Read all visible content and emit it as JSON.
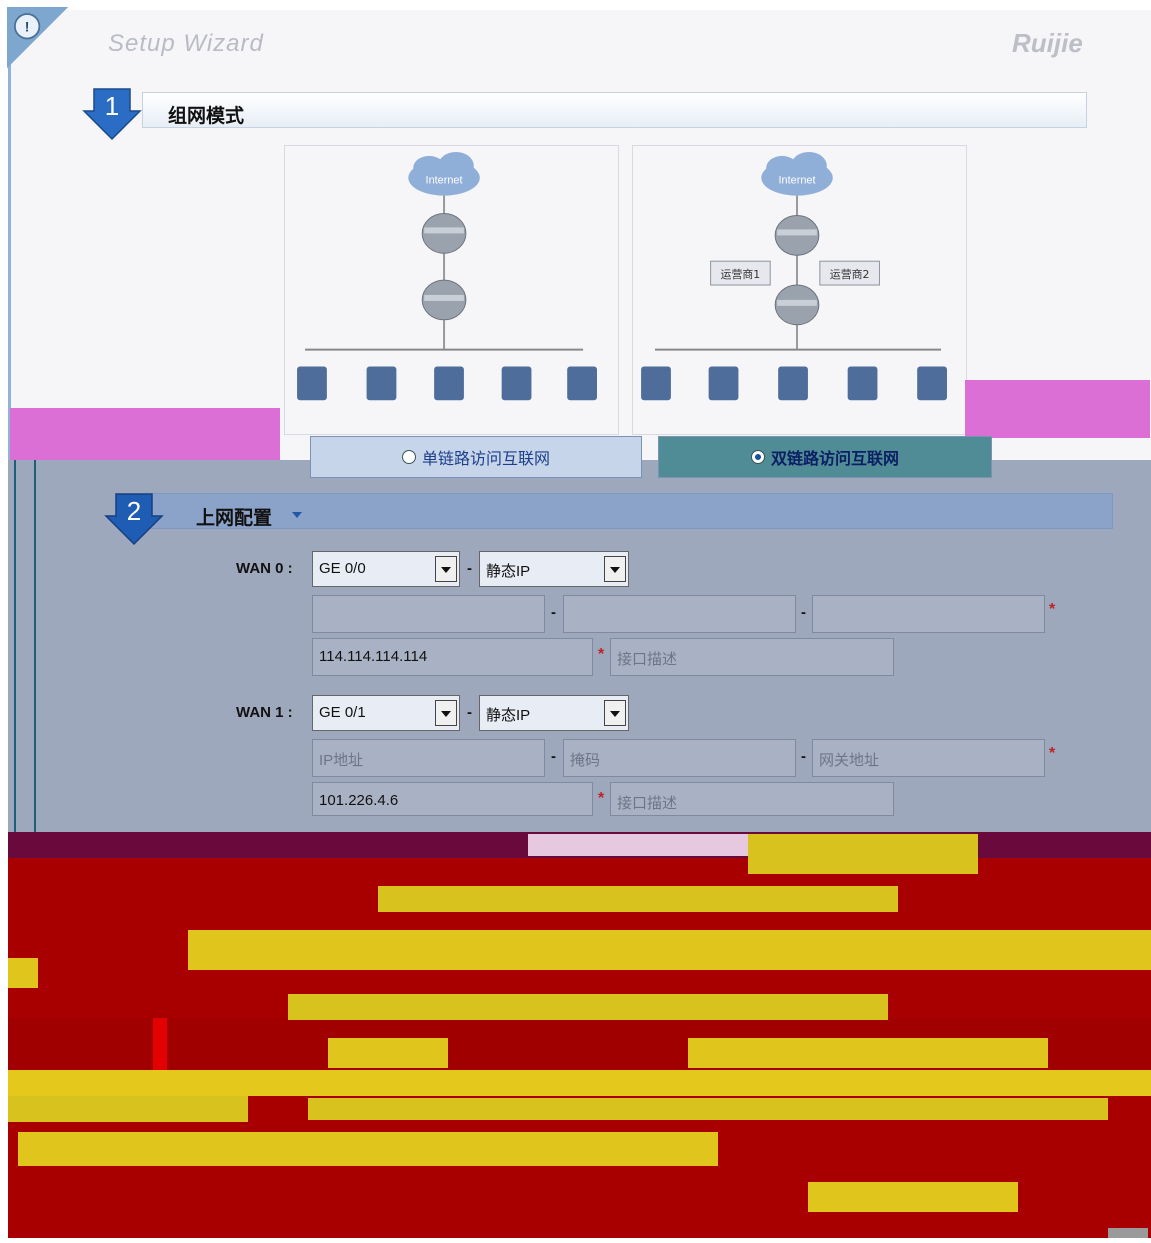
{
  "wizard": {
    "title": "Setup Wizard",
    "brand": "Ruijie"
  },
  "step1": {
    "number": "1",
    "title": "组网模式",
    "options": [
      {
        "label": "单链路访问互联网",
        "selected": false
      },
      {
        "label": "双链路访问互联网",
        "selected": true
      }
    ],
    "diagram": {
      "cloud_label": "Internet",
      "link_labels": [
        "运营商1",
        "运营商2"
      ]
    }
  },
  "step2": {
    "number": "2",
    "title": "上网配置",
    "wan0": {
      "label": "WAN 0 :",
      "interface": "GE 0/0",
      "mode": "静态IP",
      "ip": "",
      "mask": "",
      "gateway": "",
      "dns": "114.114.114.114",
      "description_placeholder": "接口描述"
    },
    "wan1": {
      "label": "WAN 1 :",
      "interface": "GE 0/1",
      "mode": "静态IP",
      "ip_placeholder": "IP地址",
      "mask_placeholder": "掩码",
      "gateway_placeholder": "网关地址",
      "dns": "101.226.4.6",
      "description_placeholder": "接口描述"
    },
    "separator": "-",
    "required_mark": "*"
  },
  "colors": {
    "accent_blue": "#1f5db5",
    "config_bg": "#9ea8bc",
    "corrupt_red": "#a80000",
    "corrupt_yellow": "#dcc21c",
    "magenta": "#dc6fd6"
  }
}
